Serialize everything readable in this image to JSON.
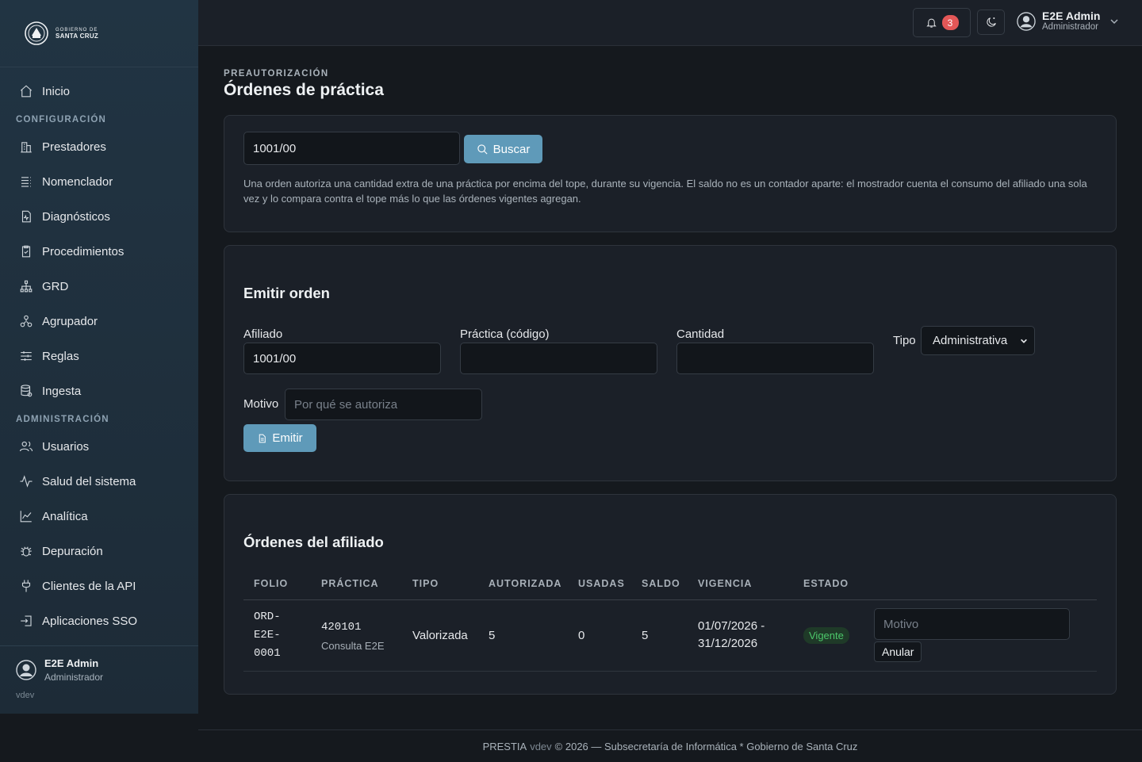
{
  "brand": {
    "line1": "GOBIERNO DE",
    "line2": "SANTA CRUZ"
  },
  "sidebar": {
    "top_items": [
      {
        "label": "Inicio",
        "icon": "home-icon"
      }
    ],
    "sections": [
      {
        "title": "CONFIGURACIÓN",
        "items": [
          {
            "label": "Prestadores",
            "icon": "building-icon"
          },
          {
            "label": "Nomenclador",
            "icon": "list-icon"
          },
          {
            "label": "Diagnósticos",
            "icon": "medical-file-icon"
          },
          {
            "label": "Procedimientos",
            "icon": "clipboard-icon"
          },
          {
            "label": "GRD",
            "icon": "hierarchy-icon"
          },
          {
            "label": "Agrupador",
            "icon": "group-icon"
          },
          {
            "label": "Reglas",
            "icon": "sliders-icon"
          },
          {
            "label": "Ingesta",
            "icon": "database-icon"
          }
        ]
      },
      {
        "title": "ADMINISTRACIÓN",
        "items": [
          {
            "label": "Usuarios",
            "icon": "users-icon"
          },
          {
            "label": "Salud del sistema",
            "icon": "pulse-icon"
          },
          {
            "label": "Analítica",
            "icon": "chart-icon"
          },
          {
            "label": "Depuración",
            "icon": "bug-icon"
          },
          {
            "label": "Clientes de la API",
            "icon": "plug-icon"
          },
          {
            "label": "Aplicaciones SSO",
            "icon": "login-icon"
          }
        ]
      }
    ],
    "user": {
      "name": "E2E Admin",
      "role": "Administrador",
      "version": "vdev"
    }
  },
  "header": {
    "notification_count": "3",
    "user": {
      "name": "E2E Admin",
      "role": "Administrador"
    }
  },
  "page": {
    "eyebrow": "PREAUTORIZACIÓN",
    "title": "Órdenes de práctica"
  },
  "search": {
    "value": "1001/00",
    "button_label": "Buscar",
    "help": "Una orden autoriza una cantidad extra de una práctica por encima del tope, durante su vigencia. El saldo no es un contador aparte: el mostrador cuenta el consumo del afiliado una sola vez y lo compara contra el tope más lo que las órdenes vigentes agregan."
  },
  "emit_form": {
    "title": "Emitir orden",
    "afiliado_label": "Afiliado",
    "afiliado_value": "1001/00",
    "practica_label": "Práctica (código)",
    "practica_value": "",
    "cantidad_label": "Cantidad",
    "cantidad_value": "",
    "tipo_label": "Tipo",
    "tipo_value": "Administrativa",
    "motivo_label": "Motivo",
    "motivo_placeholder": "Por qué se autoriza",
    "button_label": "Emitir"
  },
  "orders": {
    "title": "Órdenes del afiliado",
    "columns": [
      "FOLIO",
      "PRÁCTICA",
      "TIPO",
      "AUTORIZADA",
      "USADAS",
      "SALDO",
      "VIGENCIA",
      "ESTADO"
    ],
    "rows": [
      {
        "folio_lines": [
          "ORD-",
          "E2E-",
          "0001"
        ],
        "practica_code": "420101",
        "practica_name": "Consulta E2E",
        "tipo": "Valorizada",
        "autorizada": "5",
        "usadas": "0",
        "saldo": "5",
        "vigencia_lines": [
          "01/07/2026 -",
          "31/12/2026"
        ],
        "estado": "Vigente",
        "motivo_placeholder": "Motivo",
        "anular_label": "Anular"
      }
    ]
  },
  "footer": {
    "app": "PRESTIA",
    "version": "vdev",
    "text": "© 2026 — Subsecretaría de Informática * Gobierno de Santa Cruz"
  }
}
